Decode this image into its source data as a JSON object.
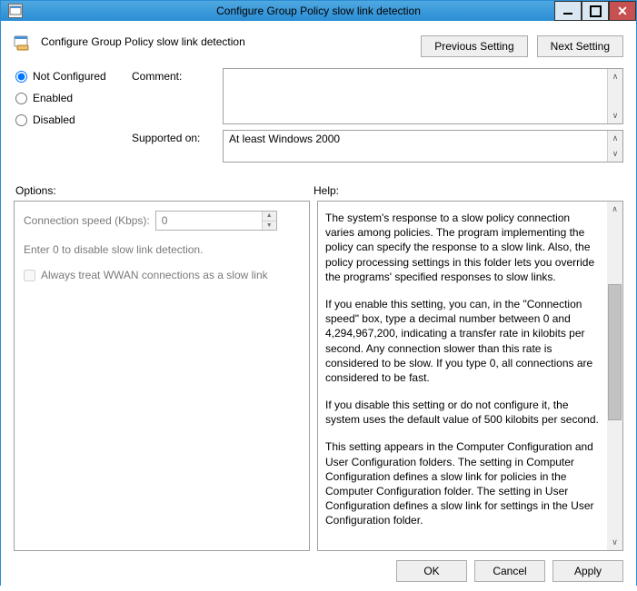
{
  "window": {
    "title": "Configure Group Policy slow link detection"
  },
  "header": {
    "policy_name": "Configure Group Policy slow link detection",
    "previous_setting": "Previous Setting",
    "next_setting": "Next Setting"
  },
  "state": {
    "not_configured": "Not Configured",
    "enabled": "Enabled",
    "disabled": "Disabled",
    "comment_label": "Comment:",
    "comment_value": "",
    "supported_label": "Supported on:",
    "supported_value": "At least Windows 2000"
  },
  "sections": {
    "options_label": "Options:",
    "help_label": "Help:"
  },
  "options": {
    "speed_label": "Connection speed (Kbps):",
    "speed_value": "0",
    "speed_hint": "Enter 0 to disable slow link detection.",
    "wwan_label": "Always treat WWAN connections as a slow link"
  },
  "help": {
    "p1": "The system's response to a slow policy connection varies among policies. The program implementing the policy can specify the response to a slow link. Also, the policy processing settings in this folder lets you override the programs' specified responses to slow links.",
    "p2": "If you enable this setting, you can, in the \"Connection speed\" box, type a decimal number between 0 and 4,294,967,200, indicating a transfer rate in kilobits per second. Any connection slower than this rate is considered to be slow. If you type 0, all connections are considered to be fast.",
    "p3": "If you disable this setting or do not configure it, the system uses the default value of 500 kilobits per second.",
    "p4": "This setting appears in the Computer Configuration and User Configuration folders. The setting in Computer Configuration defines a slow link for policies in the Computer Configuration folder. The setting in User Configuration defines a slow link for settings in the User Configuration folder."
  },
  "footer": {
    "ok": "OK",
    "cancel": "Cancel",
    "apply": "Apply"
  }
}
